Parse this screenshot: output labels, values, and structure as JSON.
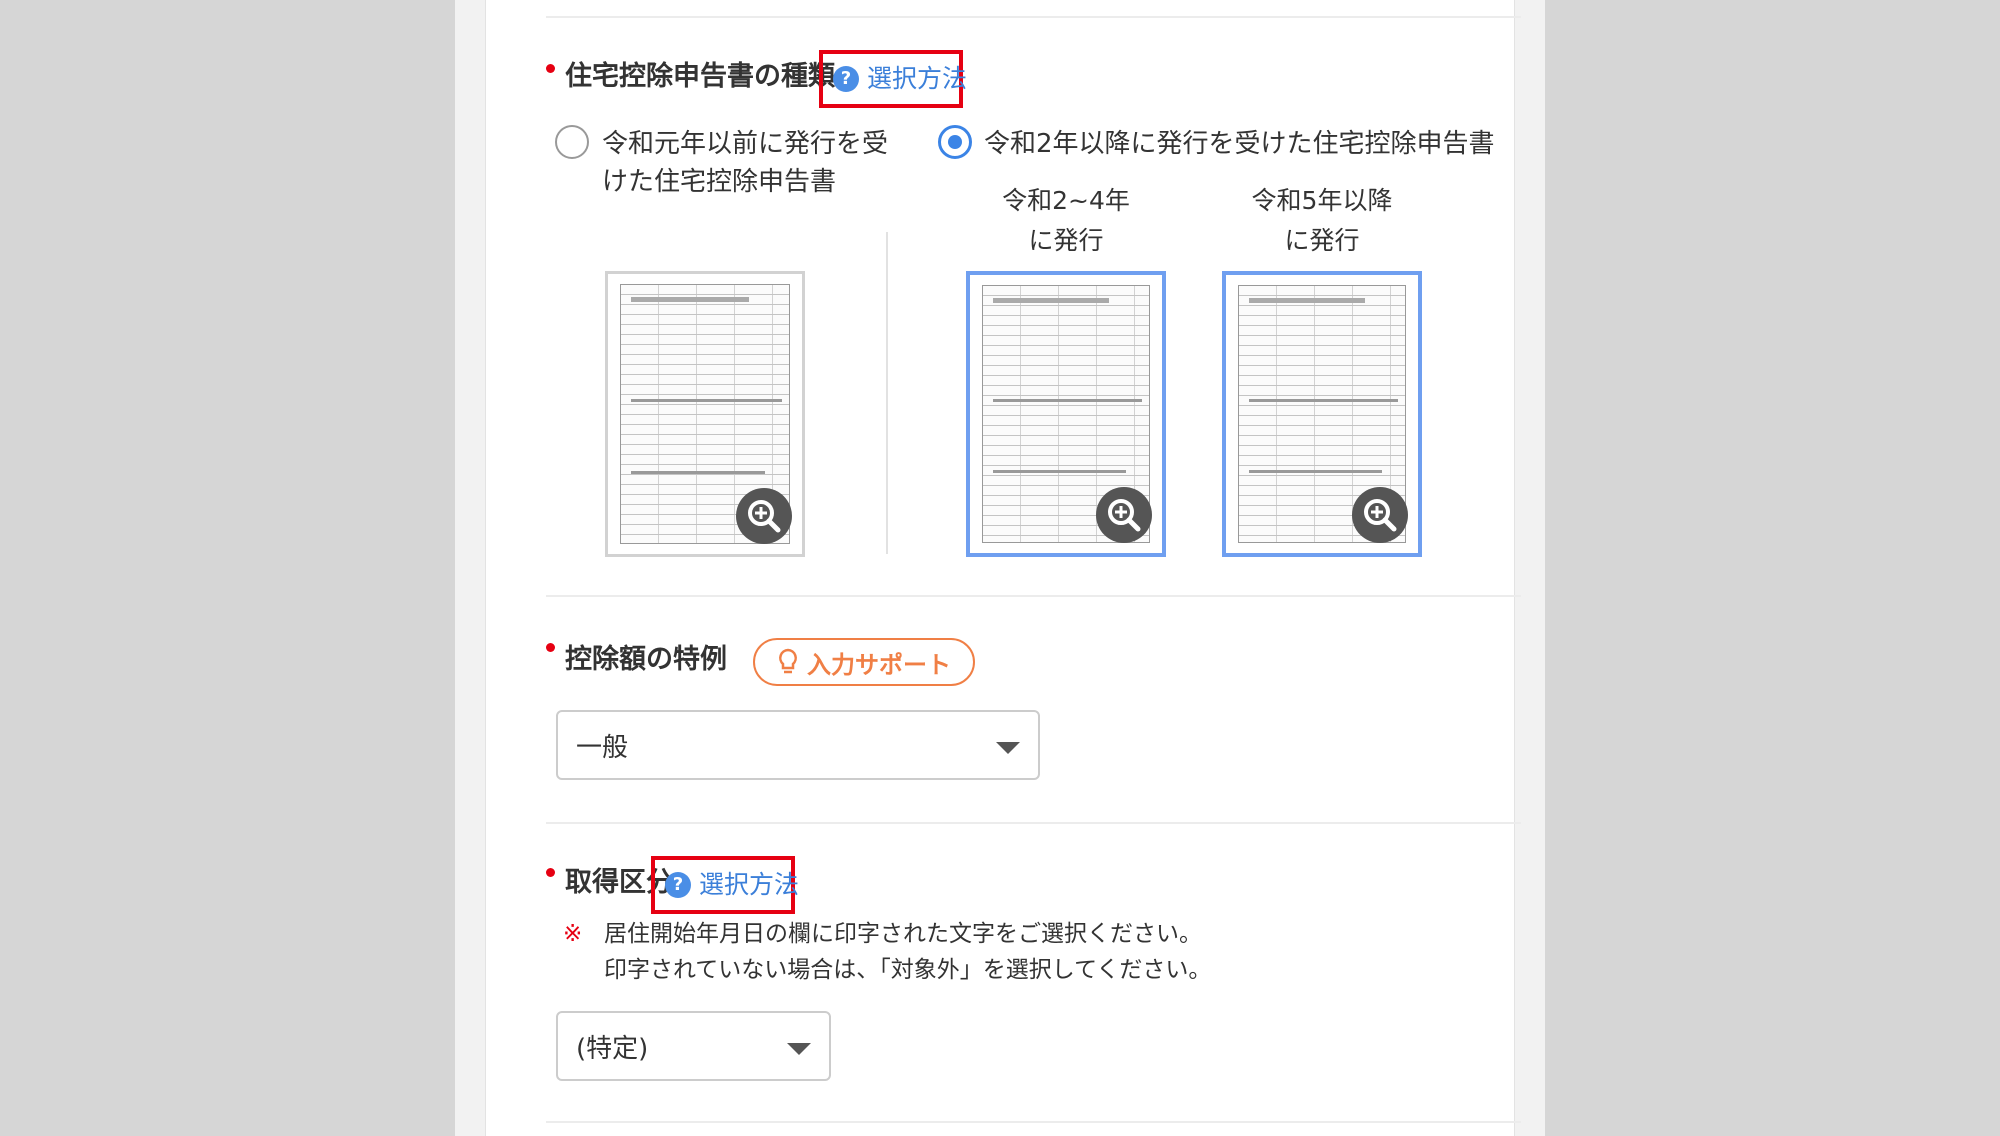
{
  "section_housing": {
    "label": "住宅控除申告書の種類",
    "help": "選択方法",
    "options": [
      {
        "label": "令和元年以前に発行を受けた住宅控除申告書",
        "line1": "令和元年以前に発行を受",
        "line2": "けた住宅控除申告書",
        "selected": false
      },
      {
        "label": "令和2年以降に発行を受けた住宅控除申告書",
        "selected": true
      }
    ],
    "captions": [
      {
        "line1": "令和2~4年",
        "line2": "に発行"
      },
      {
        "line1": "令和5年以降",
        "line2": "に発行"
      }
    ]
  },
  "section_special": {
    "label": "控除額の特例",
    "support": "入力サポート",
    "select_value": "一般"
  },
  "section_acquisition": {
    "label": "取得区分",
    "help": "選択方法",
    "note_mark": "※",
    "note_line1": "居住開始年月日の欄に印字された文字をご選択ください。",
    "note_line2": "印字されていない場合は、「対象外」を選択してください。",
    "select_value": "(特定)"
  },
  "icons": {
    "help": "question-circle-icon",
    "zoom": "zoom-in-icon",
    "support": "lightbulb-icon",
    "dropdown": "caret-down-icon"
  },
  "colors": {
    "required": "#e60012",
    "link": "#3b7fd9",
    "radio_on": "#3b84e6",
    "support": "#f07f45",
    "highlight": "#e60012"
  }
}
